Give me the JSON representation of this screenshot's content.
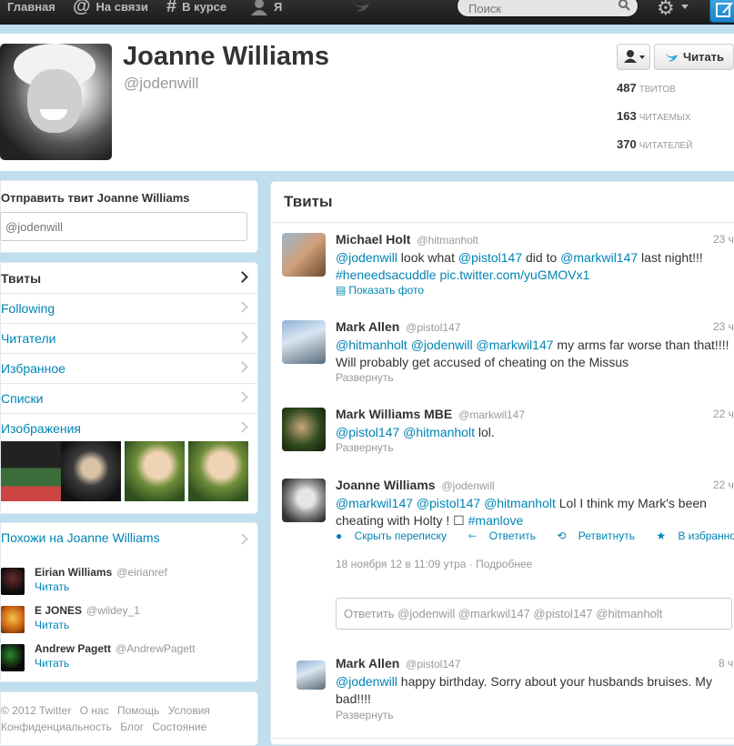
{
  "nav": {
    "home": "Главная",
    "connect": "На связи",
    "discover": "В курсе",
    "me": "Я",
    "search_placeholder": "Поиск"
  },
  "profile": {
    "name": "Joanne Williams",
    "handle": "@jodenwill",
    "follow_label": "Читать",
    "stats": [
      {
        "value": "487",
        "label": "твитов"
      },
      {
        "value": "163",
        "label": "читаемых"
      },
      {
        "value": "370",
        "label": "читателей"
      }
    ]
  },
  "tweet_to": {
    "title": "Отправить твит Joanne Williams",
    "placeholder": "@jodenwill"
  },
  "sidebar": {
    "items": [
      {
        "label": "Твиты"
      },
      {
        "label": "Following"
      },
      {
        "label": "Читатели"
      },
      {
        "label": "Избранное"
      },
      {
        "label": "Списки"
      },
      {
        "label": "Изображения"
      }
    ]
  },
  "similar": {
    "title": "Похожи на Joanne Williams",
    "follow_label": "Читать",
    "users": [
      {
        "name": "Eirian Williams",
        "handle": "@eirianref"
      },
      {
        "name": "E JONES",
        "handle": "@wildey_1"
      },
      {
        "name": "Andrew Pagett",
        "handle": "@AndrewPagett"
      }
    ]
  },
  "footer": {
    "row1": [
      "© 2012 Twitter",
      "О нас",
      "Помощь",
      "Условия"
    ],
    "row2": [
      "Конфиденциальность",
      "Блог",
      "Состояние"
    ]
  },
  "stream": {
    "title": "Твиты",
    "tweets": [
      {
        "name": "Michael Holt",
        "handle": "@hitmanholt",
        "time": "23 ч",
        "text_parts": [
          "@jodenwill",
          " look what ",
          "@pistol147",
          " did to ",
          "@markwil147",
          " last night!!! ",
          "#heneedsacuddle",
          " ",
          "pic.twitter.com/yuGMOVx1"
        ],
        "action": "Показать фото"
      },
      {
        "name": "Mark Allen",
        "handle": "@pistol147",
        "time": "23 ч",
        "text_parts": [
          "@hitmanholt",
          " ",
          "@jodenwill",
          " ",
          "@markwil147",
          " my arms far worse than that!!!! Will probably get accused of cheating on the Missus"
        ],
        "action": "Развернуть"
      },
      {
        "name": "Mark Williams MBE",
        "handle": "@markwil147",
        "time": "22 ч",
        "text_parts": [
          "@pistol147",
          " ",
          "@hitmanholt",
          " lol."
        ],
        "action": "Развернуть"
      },
      {
        "name": "Joanne Williams",
        "handle": "@jodenwill",
        "time": "22 ч",
        "text_parts": [
          "@markwil147",
          " ",
          "@pistol147",
          " ",
          "@hitmanholt",
          " Lol I think my Mark's been cheating with Holty ! ",
          "☐",
          " ",
          "#manlove"
        ],
        "actions": [
          "Скрыть переписку",
          "Ответить",
          "Ретвитнуть",
          "В избранное"
        ],
        "meta": "18 ноября 12 в 11:09 утра · Подробнее",
        "reply_placeholder": "Ответить @jodenwill @markwil147 @pistol147 @hitmanholt"
      },
      {
        "name": "Mark Allen",
        "handle": "@pistol147",
        "time": "8 ч",
        "text_parts": [
          "@jodenwill",
          " happy birthday. Sorry about your husbands bruises. My bad!!!!"
        ],
        "action": "Развернуть"
      }
    ]
  },
  "colors": {
    "link": "#0084b4",
    "background": "#c0deed",
    "topbar": "#222222"
  }
}
